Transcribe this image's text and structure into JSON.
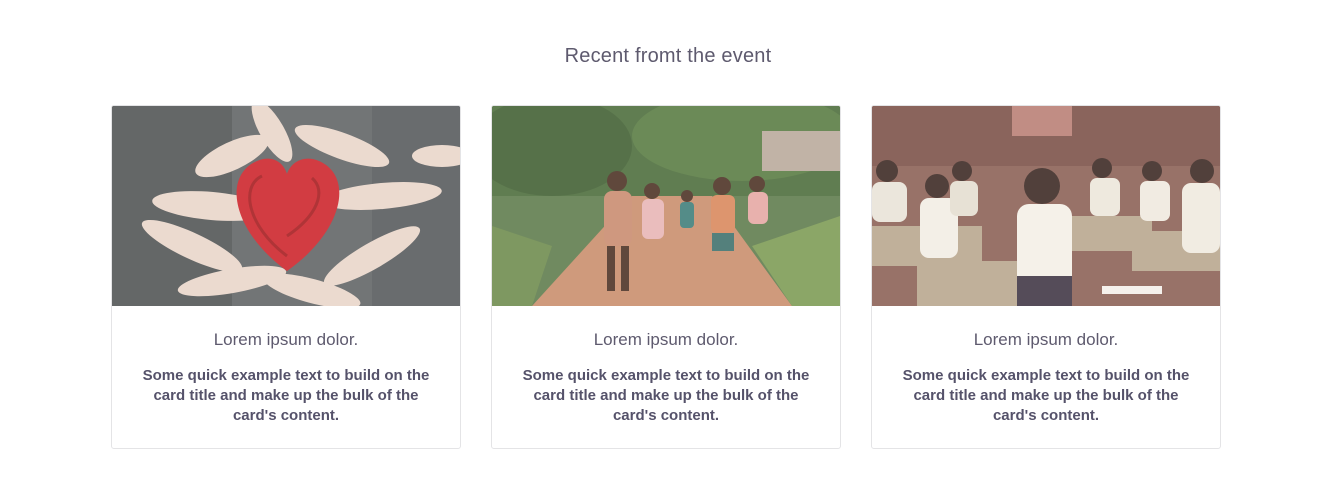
{
  "section": {
    "title": "Recent fromt the event"
  },
  "cards": [
    {
      "image_subject": "hands painted red forming a heart",
      "title": "Lorem ipsum dolor.",
      "text": "Some quick example text to build on the card title and make up the bulk of the card's content."
    },
    {
      "image_subject": "children running on a dirt path",
      "title": "Lorem ipsum dolor.",
      "text": "Some quick example text to build on the card title and make up the bulk of the card's content."
    },
    {
      "image_subject": "students sitting at classroom desks",
      "title": "Lorem ipsum dolor.",
      "text": "Some quick example text to build on the card title and make up the bulk of the card's content."
    }
  ]
}
